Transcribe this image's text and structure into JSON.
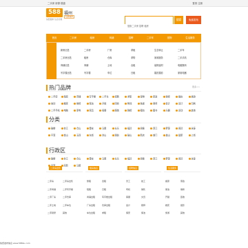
{
  "topbar": {
    "left": "二手房 房源 楼盘",
    "right": "登录 注册"
  },
  "logo": {
    "text": "588"
  },
  "city": {
    "name": "福州",
    "switch": "切换城市",
    "slogan": "免费发布 信息分类"
  },
  "search": {
    "placeholder": "搜索二手房 招聘 租房",
    "button": "搜索",
    "post": "免费发布"
  },
  "nav": [
    "首页",
    "二手房",
    "租房",
    "商铺",
    "招聘",
    "二手车",
    "宠物",
    "生活服务"
  ],
  "categories": [
    [
      "新房出售",
      "二手房出售",
      "商铺出售",
      "写字楼出售"
    ],
    [
      "二手房",
      "租房",
      "商铺",
      "写字楼"
    ],
    [
      "厂房",
      "仓库",
      "土地",
      "车位"
    ],
    [
      "求租",
      "求购",
      "合租",
      "日租"
    ],
    [
      "生意转让",
      "家政服务",
      "装修建材",
      "婚庆摄影"
    ],
    [
      "二手车",
      "二手手机",
      "电脑数码",
      "家用电器"
    ]
  ],
  "hot": {
    "title": "热门品牌",
    "more": "更多>>",
    "items": [
      [
        "二手房",
        "租房",
        "商铺",
        "写字楼",
        "二手车",
        "招聘",
        "求职",
        "宠物",
        "家政",
        "装修",
        "婚庆",
        "旅游"
      ],
      [
        "培训",
        "搬家",
        "维修",
        "保洁",
        "开锁",
        "回收",
        "物流",
        "快递",
        "律师",
        "会计",
        "设计",
        "印刷"
      ],
      [
        "二手手机",
        "电脑",
        "家电",
        "家具",
        "母婴",
        "服装",
        "鞋帽",
        "箱包",
        "图书",
        "乐器",
        "运动",
        "其他"
      ]
    ]
  },
  "sub": {
    "title": "分类",
    "items": [
      [
        "鼓楼",
        "台江",
        "仓山",
        "晋安",
        "马尾",
        "长乐",
        "福清",
        "闽侯",
        "连江",
        "罗源",
        "闽清",
        "永泰"
      ],
      [
        "平潭",
        "金山",
        "五四",
        "东街",
        "洪山",
        "湖前",
        "鼓山",
        "新店",
        "城门",
        "盖山",
        "建新",
        "上街"
      ]
    ]
  },
  "area": {
    "title": "行政区",
    "items": [
      [
        "鼓楼",
        "台江",
        "仓山",
        "晋安",
        "马尾",
        "长乐",
        "福清",
        "闽侯",
        "连江",
        "罗源",
        "闽清",
        "永泰"
      ],
      [
        "平潭",
        "高新",
        "马尾"
      ]
    ]
  },
  "columns": [
    {
      "chip": "二手房出售",
      "items": [
        "二手房",
        "二手房出售",
        "二手商铺",
        "二手写字楼",
        "二手厂房",
        "二手仓库",
        "二手土地",
        "二手车位",
        "二手别墅",
        "其他"
      ]
    },
    {
      "chip": "租房信息",
      "items": [
        "整租",
        "合租",
        "短租",
        "日租",
        "商铺出租",
        "写字楼出租",
        "厂房出租",
        "仓库出租",
        "车位出租",
        "求租"
      ]
    },
    {
      "chip": "招聘信息",
      "items": [
        "普工",
        "技工",
        "司机",
        "销售",
        "客服",
        "文员",
        "会计",
        "厨师",
        "保安",
        "保洁"
      ]
    },
    {
      "chip": "生活服务",
      "items": [
        "搬家",
        "家政",
        "保洁",
        "维修",
        "开锁",
        "回收",
        "婚庆",
        "摄影",
        "旅游",
        "其他"
      ]
    }
  ],
  "footer": "免费发布信息 www.588ku.com"
}
